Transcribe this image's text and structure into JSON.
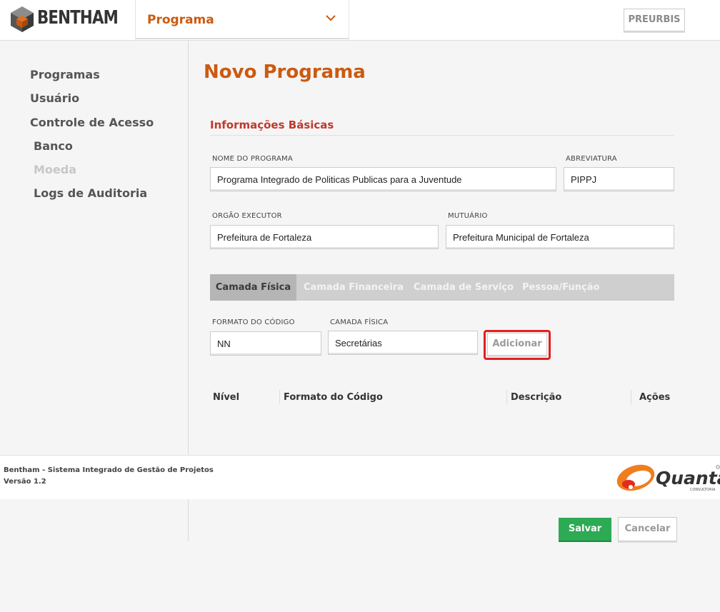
{
  "header": {
    "logo_text": "BENTHAM",
    "program_select": {
      "value": "Programa"
    },
    "preurbis_label": "PREURBIS"
  },
  "sidebar": {
    "items": [
      {
        "label": "Programas"
      },
      {
        "label": "Usuário"
      },
      {
        "label": "Controle de Acesso"
      },
      {
        "label": "Banco"
      },
      {
        "label": "Moeda",
        "disabled": true
      },
      {
        "label": "Logs de Auditoria"
      }
    ]
  },
  "main": {
    "title": "Novo Programa",
    "section_title": "Informações Básicas",
    "fields": {
      "nome": {
        "label": "NOME DO PROGRAMA",
        "value": "Programa Integrado de Politicas Publicas para a Juventude"
      },
      "abreviatura": {
        "label": "ABREVIATURA",
        "value": "PIPPJ"
      },
      "orgao": {
        "label": "ORGÃO EXECUTOR",
        "value": "Prefeitura de Fortaleza"
      },
      "mutuario": {
        "label": "MUTUÁRIO",
        "value": "Prefeitura Municipal de Fortaleza"
      }
    },
    "tabs": [
      {
        "label": "Camada Física",
        "active": true
      },
      {
        "label": "Camada Financeira"
      },
      {
        "label": "Camada de Serviço"
      },
      {
        "label": "Pessoa/Função"
      }
    ],
    "camada": {
      "formato_label": "FORMATO DO CÓDIGO",
      "formato_value": "NN",
      "camada_label": "CAMADA FÍSICA",
      "camada_value": "Secretárias",
      "add_label": "Adicionar"
    },
    "table": {
      "headers": [
        "Nível",
        "Formato do Código",
        "Descrição",
        "Ações"
      ]
    }
  },
  "footer": {
    "line1": "Bentham - Sistema Integrado de Gestão de Projetos",
    "line2": "Versão 1.2",
    "partner_logo_text": "Quanta",
    "partner_logo_subtext": "CONSULTORIA"
  },
  "actions": {
    "save_label": "Salvar",
    "cancel_label": "Cancelar"
  },
  "colors": {
    "accent": "#cc5a0f",
    "section": "#c0392b",
    "save": "#2daa54",
    "highlight": "#e41f1f"
  },
  "icons": {
    "logo": "bentham-cube-icon",
    "dropdown": "chevron-down-icon",
    "partner": "quanta-logo"
  }
}
